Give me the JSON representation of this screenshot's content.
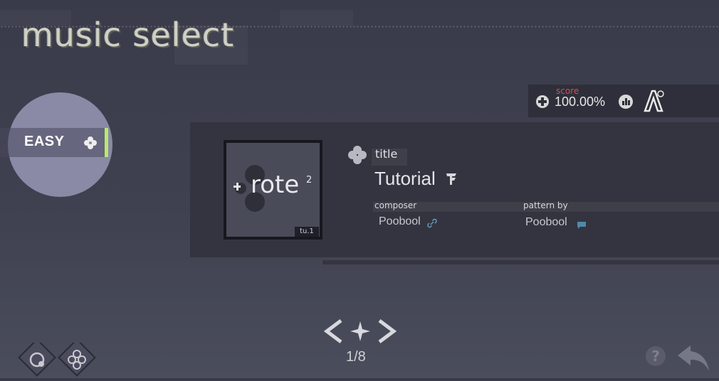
{
  "header": {
    "title": "music select"
  },
  "difficulty": {
    "label": "EASY",
    "accent_color": "#b9e86a"
  },
  "score": {
    "label": "score",
    "value": "100.00%"
  },
  "song": {
    "title_label": "title",
    "title": "Tutorial",
    "composer_label": "composer",
    "composer": "Poobool",
    "pattern_label": "pattern by",
    "pattern_by": "Poobool",
    "jacket_text": "rote",
    "jacket_sup": "2",
    "jacket_version": "tu.1"
  },
  "pagination": {
    "current": "1/8"
  },
  "icons": {
    "difficulty": "clover-icon",
    "score": "plus-circle-icon",
    "rank": "rank-icon",
    "grade": "grade-a-icon",
    "title": "clover-icon",
    "flag": "flag-icon",
    "link": "link-icon",
    "message": "message-icon",
    "prev": "chevron-left-icon",
    "next": "chevron-right-icon",
    "center": "star-icon",
    "settings": "gear-diamond-icon",
    "mode": "clover-diamond-icon",
    "help": "help-icon",
    "back": "back-arrow-icon"
  }
}
